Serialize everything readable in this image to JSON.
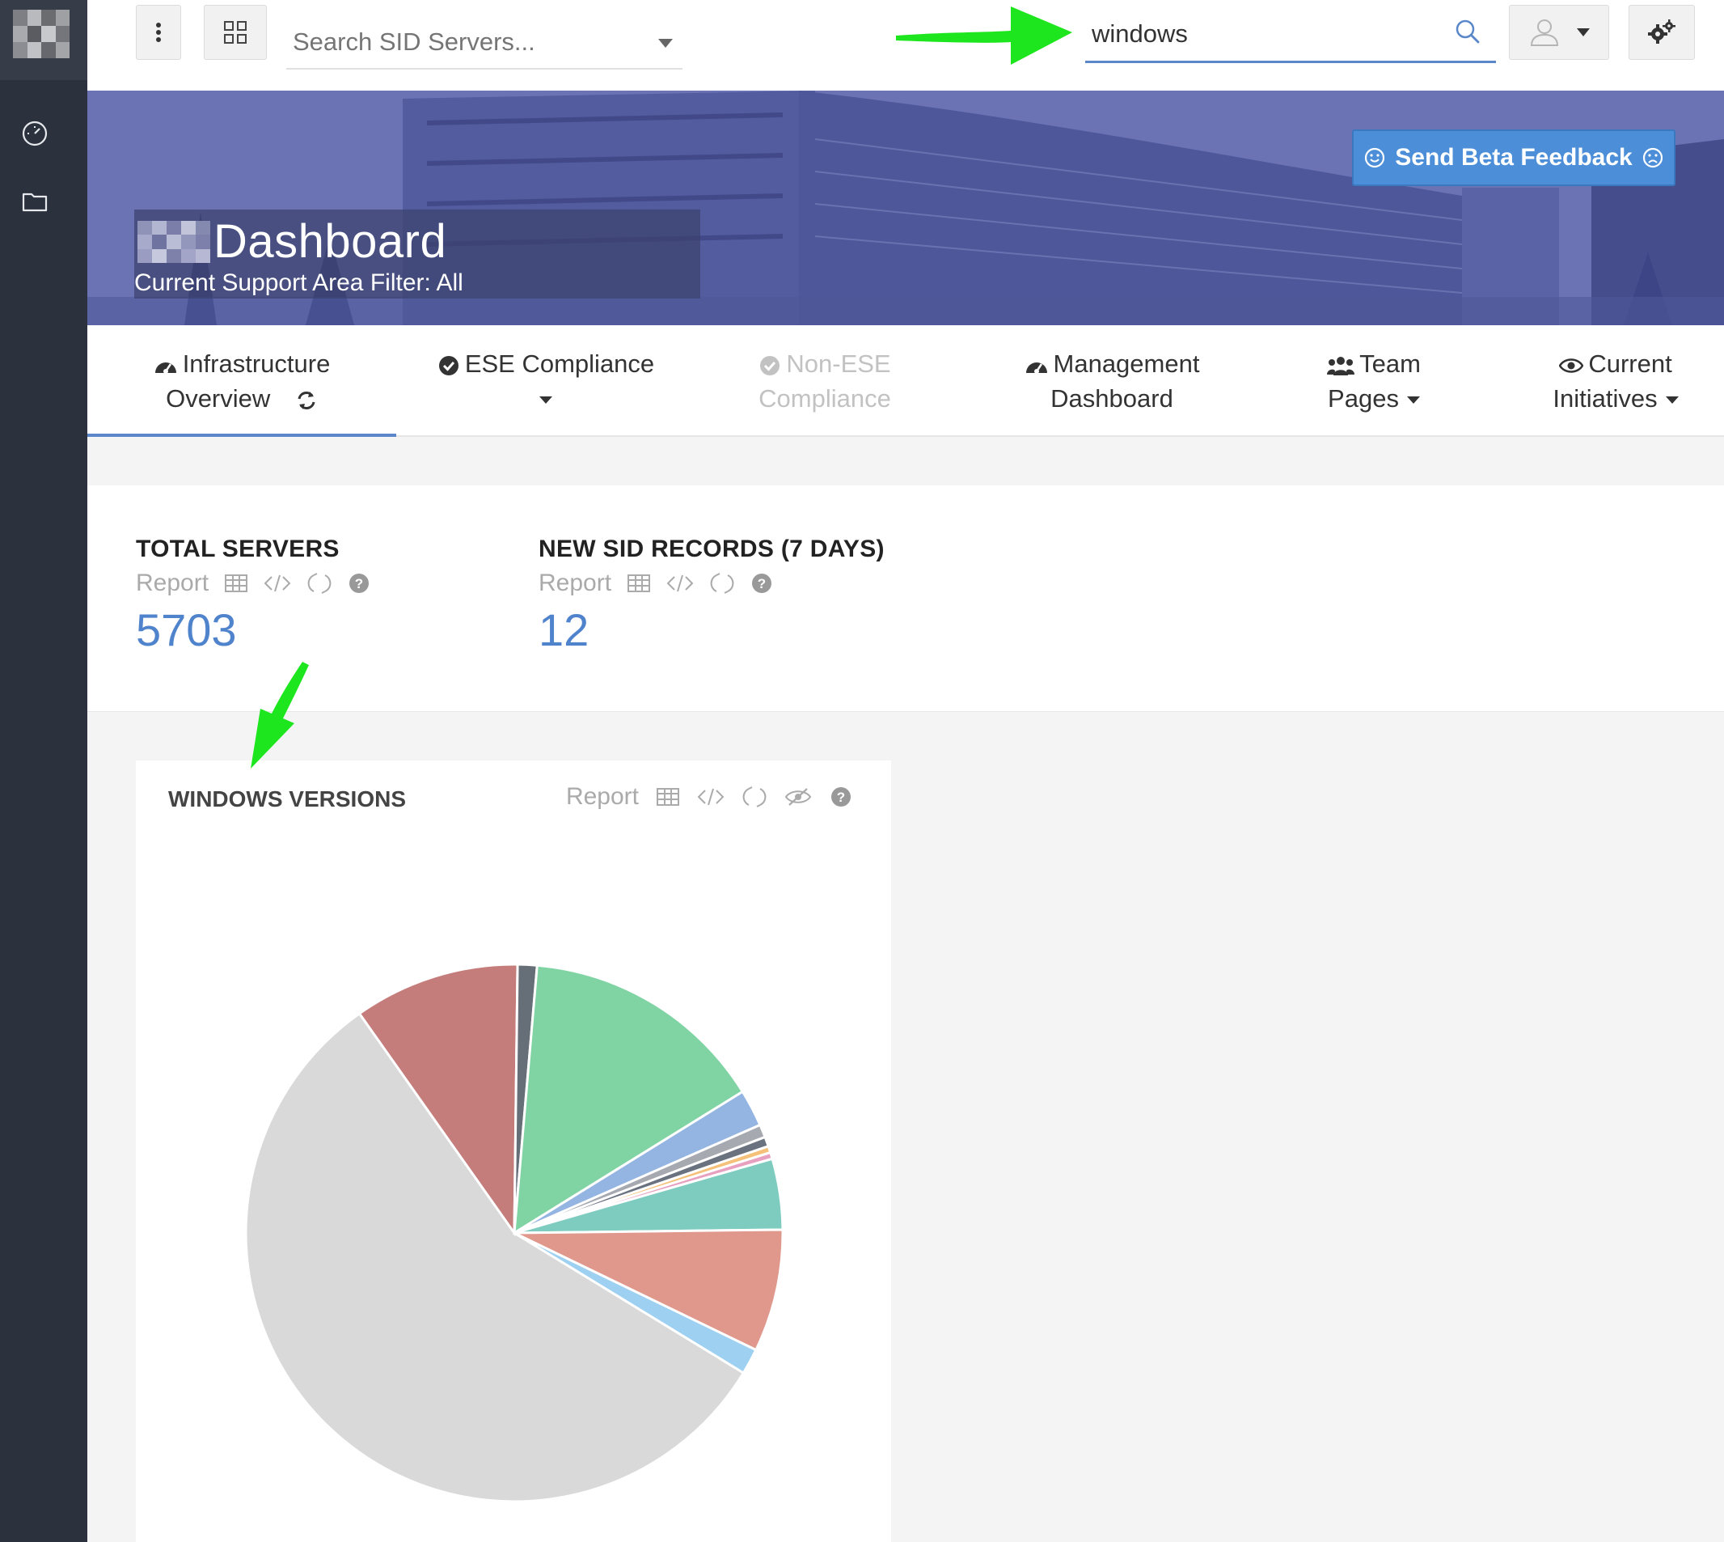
{
  "colors": {
    "accent": "#5b86c9",
    "rail": "#2b323d",
    "feedback": "#4c8fd8",
    "stat_value": "#4f83cc",
    "annotation": "#1ee61e"
  },
  "topbar": {
    "server_search_placeholder": "Search SID Servers...",
    "global_search_value": "windows"
  },
  "hero": {
    "title": "Dashboard",
    "filter": "Current Support Area Filter: All",
    "feedback_label": "Send Beta Feedback"
  },
  "tabs": [
    {
      "line1": "Infrastructure",
      "line2": "Overview",
      "icon": "dashboard-icon",
      "active": true
    },
    {
      "line1": "ESE Compliance",
      "line2": "",
      "icon": "check-circle-icon",
      "dropdown": true
    },
    {
      "line1": "Non-ESE",
      "line2": "Compliance",
      "icon": "check-circle-icon",
      "disabled": true
    },
    {
      "line1": "Management",
      "line2": "Dashboard",
      "icon": "dashboard-icon"
    },
    {
      "line1": "Team",
      "line2": "Pages",
      "icon": "users-icon",
      "dropdown": true
    },
    {
      "line1": "Current",
      "line2": "Initiatives",
      "icon": "eye-icon",
      "dropdown": true
    }
  ],
  "stats": [
    {
      "label": "TOTAL SERVERS",
      "report": "Report",
      "value": "5703"
    },
    {
      "label": "NEW SID RECORDS (7 DAYS)",
      "report": "Report",
      "value": "12"
    }
  ],
  "card": {
    "title": "WINDOWS VERSIONS",
    "report": "Report"
  },
  "chart_data": {
    "type": "pie",
    "title": "",
    "start_angle_deg": 31.4,
    "slices": [
      {
        "value": 58.3,
        "color": "#d9d9d9"
      },
      {
        "value": 10.3,
        "color": "#c47d7b"
      },
      {
        "value": 1.2,
        "color": "#666e78"
      },
      {
        "value": 15.3,
        "color": "#80d4a4"
      },
      {
        "value": 2.3,
        "color": "#94b4e2"
      },
      {
        "value": 0.8,
        "color": "#a6a9b0"
      },
      {
        "value": 0.6,
        "color": "#6a7280"
      },
      {
        "value": 0.4,
        "color": "#f5c17a"
      },
      {
        "value": 0.4,
        "color": "#e7a0c0"
      },
      {
        "value": 4.4,
        "color": "#7ecbbf"
      },
      {
        "value": 7.6,
        "color": "#e0978c"
      },
      {
        "value": 1.6,
        "color": "#9ed0f2"
      }
    ]
  }
}
